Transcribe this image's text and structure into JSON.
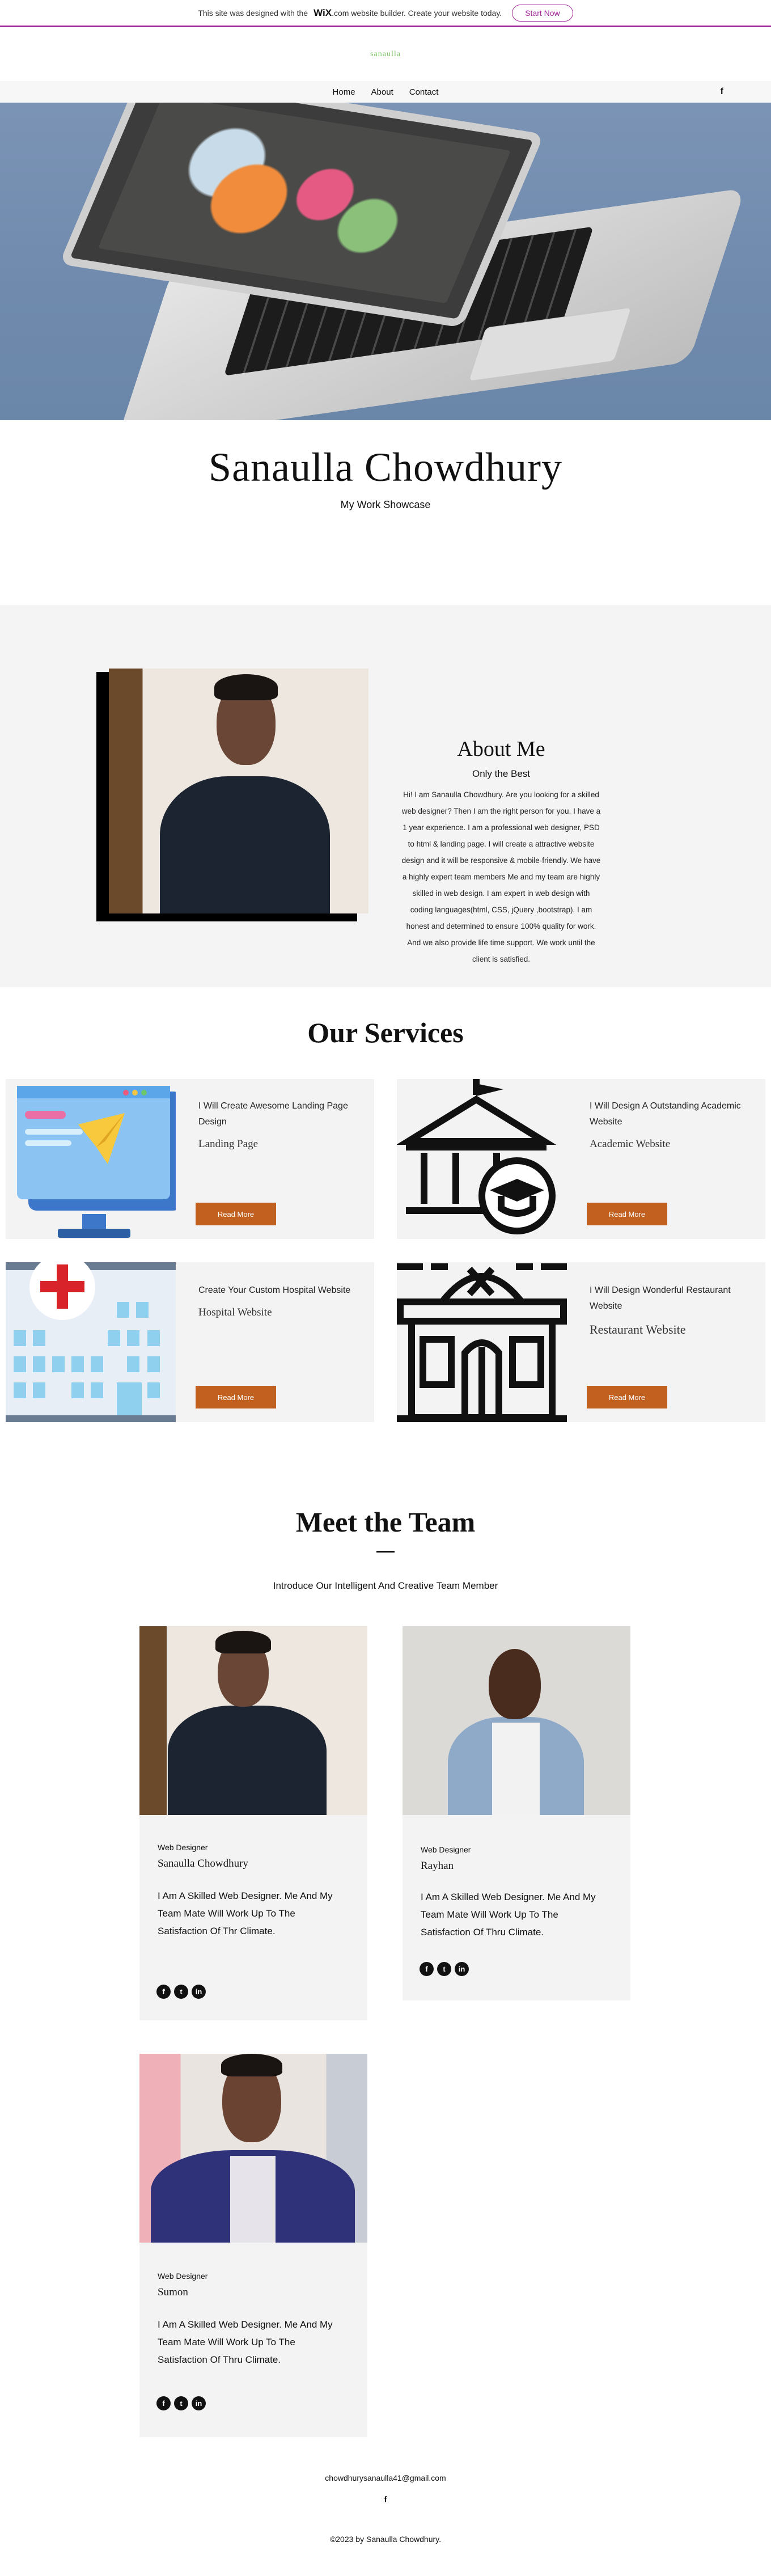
{
  "banner": {
    "pre_text": "This site was designed with the",
    "wix_logo": "WiX",
    "post_text": ".com website builder. Create your website today.",
    "cta": "Start Now",
    "accent_color": "#a52a9c"
  },
  "header": {
    "logo_text": "sanaulla",
    "nav": [
      "Home",
      "About",
      "Contact"
    ],
    "social_icon": "f"
  },
  "hero": {
    "title": "Sanaulla Chowdhury",
    "subtitle": "My Work Showcase"
  },
  "about": {
    "title": "About Me",
    "subtitle": "Only the Best",
    "body": "Hi! I am Sanaulla Chowdhury. Are you looking for a skilled web designer? Then I am the right person for you. I have a 1 year experience. I am a professional web designer, PSD to html & landing page. I will create a attractive website design and it will be responsive & mobile-friendly. We have a highly expert team members Me and my team are highly skilled in web design. I am expert in web design with coding languages(html, CSS, jQuery ,bootstrap). I am honest and determined to ensure 100% quality for work. And we also provide life time support. We work until the client is satisfied."
  },
  "services": {
    "title": "Our Services",
    "items": [
      {
        "heading": "I Will Create Awesome Landing Page Design",
        "sub": "Landing Page",
        "button": "Read More",
        "icon": "landing-page-icon"
      },
      {
        "heading": "I Will Design A Outstanding Academic Website",
        "sub": "Academic Website",
        "button": "Read More",
        "icon": "academic-building-icon"
      },
      {
        "heading": "Create Your Custom Hospital Website",
        "sub": "Hospital Website",
        "button": "Read More",
        "icon": "hospital-icon"
      },
      {
        "heading": "I Will Design Wonderful Restaurant Website",
        "sub": "Restaurant Website",
        "button": "Read More",
        "icon": "restaurant-icon"
      }
    ],
    "button_color": "#c1601f"
  },
  "team": {
    "title": "Meet the Team",
    "subtitle": "Introduce Our Intelligent And Creative Team Member",
    "members": [
      {
        "role": "Web Designer",
        "name": "Sanaulla Chowdhury",
        "desc": "I Am A Skilled Web Designer. Me And My Team Mate Will Work Up To The Satisfaction Of Thr Climate."
      },
      {
        "role": "Web Designer",
        "name": "Rayhan",
        "desc": "I Am A Skilled Web Designer. Me And My Team Mate Will Work Up To The Satisfaction Of Thru Climate."
      },
      {
        "role": "Web Designer",
        "name": "Sumon",
        "desc": "I Am A Skilled Web Designer. Me And My Team Mate Will Work Up To The Satisfaction Of Thru Climate."
      }
    ],
    "social_icons": [
      "f",
      "t",
      "in"
    ]
  },
  "footer": {
    "email": "chowdhurysanaulla41@gmail.com",
    "social_icon": "f",
    "copyright": "©2023 by Sanaulla Chowdhury."
  }
}
